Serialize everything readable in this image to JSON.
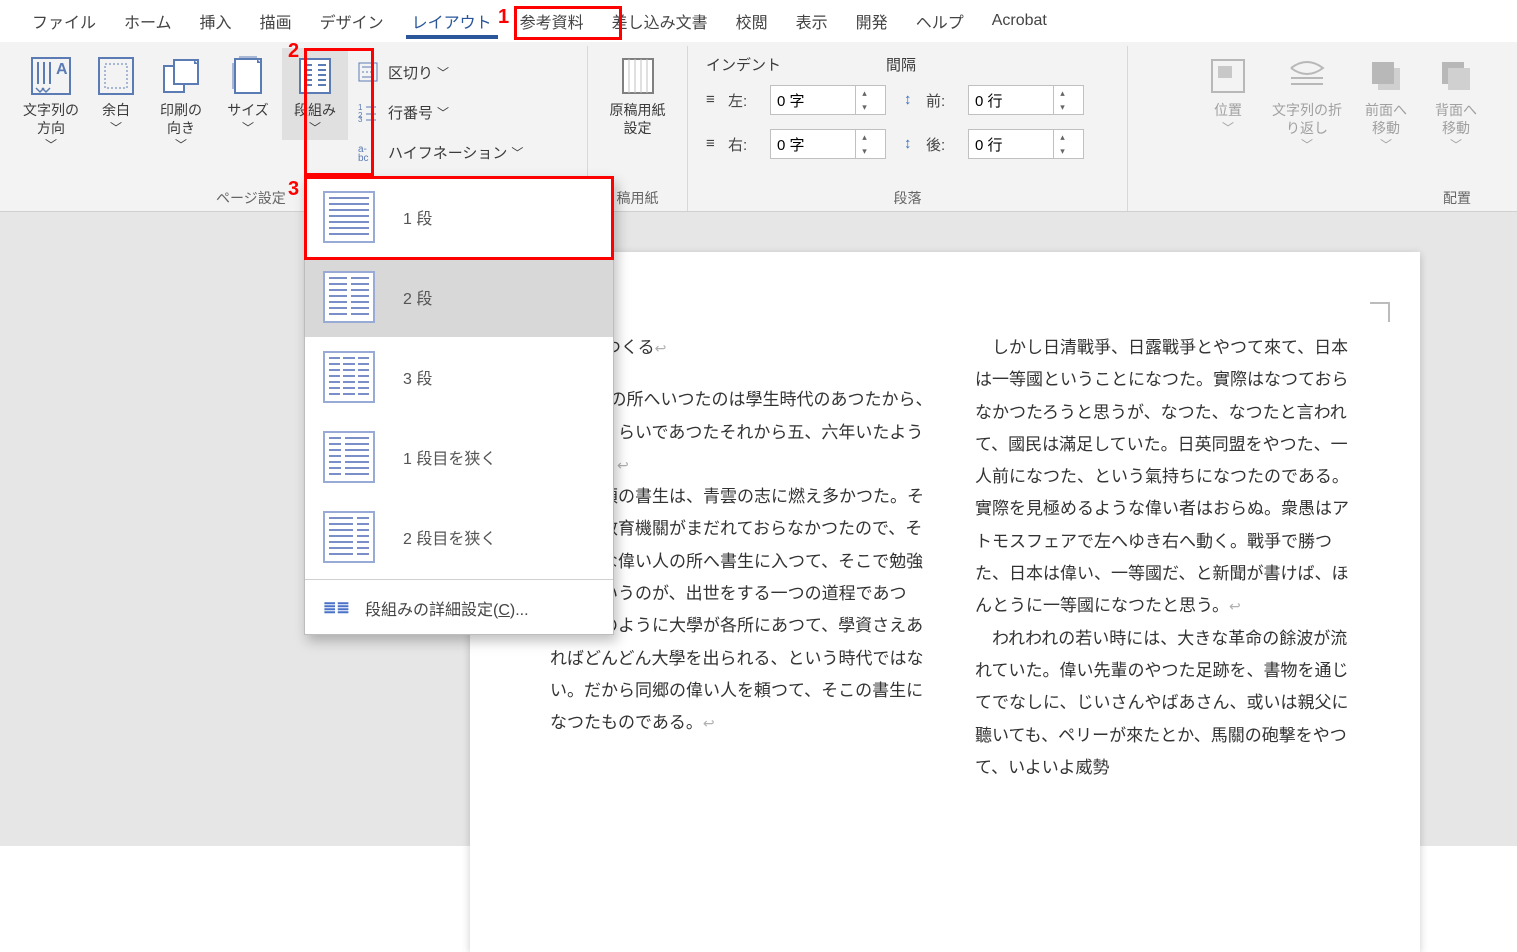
{
  "tabs": {
    "file": "ファイル",
    "home": "ホーム",
    "insert": "挿入",
    "draw": "描画",
    "design": "デザイン",
    "layout": "レイアウト",
    "references": "参考資料",
    "mailings": "差し込み文書",
    "review": "校閲",
    "view": "表示",
    "developer": "開発",
    "help": "ヘルプ",
    "acrobat": "Acrobat"
  },
  "ribbon": {
    "text_direction": "文字列の\n方向",
    "margins": "余白",
    "orientation": "印刷の\n向き",
    "size": "サイズ",
    "columns": "段組み",
    "breaks": "区切り",
    "line_numbers": "行番号",
    "hyphenation": "ハイフネーション",
    "manuscript": "原稿用紙\n設定",
    "indent_header": "インデント",
    "spacing_header": "間隔",
    "indent_left_label": "左:",
    "indent_left_value": "0 字",
    "indent_right_label": "右:",
    "indent_right_value": "0 字",
    "spacing_before_label": "前:",
    "spacing_before_value": "0 行",
    "spacing_after_label": "後:",
    "spacing_after_value": "0 行",
    "position": "位置",
    "wrap_text": "文字列の折\nり返し",
    "bring_forward": "前面へ\n移動",
    "send_backward": "背面へ\n移動",
    "group_page_setup": "ページ設定",
    "group_manuscript": "稿用紙",
    "group_paragraph": "段落",
    "group_arrange": "配置"
  },
  "dropdown": {
    "one": "1 段",
    "two": "2 段",
    "three": "3 段",
    "narrow_first": "1 段目を狭く",
    "narrow_second": "2 段目を狭く",
    "more_pre": "段組みの詳細設定(",
    "more_key": "C",
    "more_post": ")..."
  },
  "callouts": {
    "c1": "1",
    "c2": "2",
    "c3": "3"
  },
  "document": {
    "title": "人をつくる",
    "col1_indent": "　#上侯の所へいつたのは學生時代のあつたから、二十歳くらいであつたそれから五、六年いたように思う。",
    "col1_body": "切期の頃の書生は、青雲の志に燃え多かつた。その頃は教育機關がまだれておらなかつたので、そのような偉い人の所へ書生に入つて、そこで勉強するというのが、出世をする一つの道程であつた。今のように大學が各所にあつて、學資さえあればどんどん大學を出られる、という時代ではない。だから同郷の偉い人を頼つて、そこの書生になつたものである。",
    "col2_indent": "　しかし日清戰爭、日露戰爭とやつて來て、日本は一等國ということになつた。實際はなつておらなかつたろうと思うが、なつた、なつたと言われて、國民は滿足していた。日英同盟をやつた、一人前になつた、という氣持ちになつたのである。實際を見極めるような偉い者はおらぬ。衆愚はアトモスフェアで左へゆき右へ動く。戰爭で勝つた、日本は偉い、一等國だ、と新聞が書けば、ほんとうに一等國になつたと思う。",
    "col2_para2": "　われわれの若い時には、大きな革命の餘波が流れていた。偉い先輩のやつた足跡を、書物を通じてでなしに、じいさんやばあさん、或いは親父に聽いても、ペリーが來たとか、馬關の砲撃をやつて、いよいよ威勢"
  }
}
